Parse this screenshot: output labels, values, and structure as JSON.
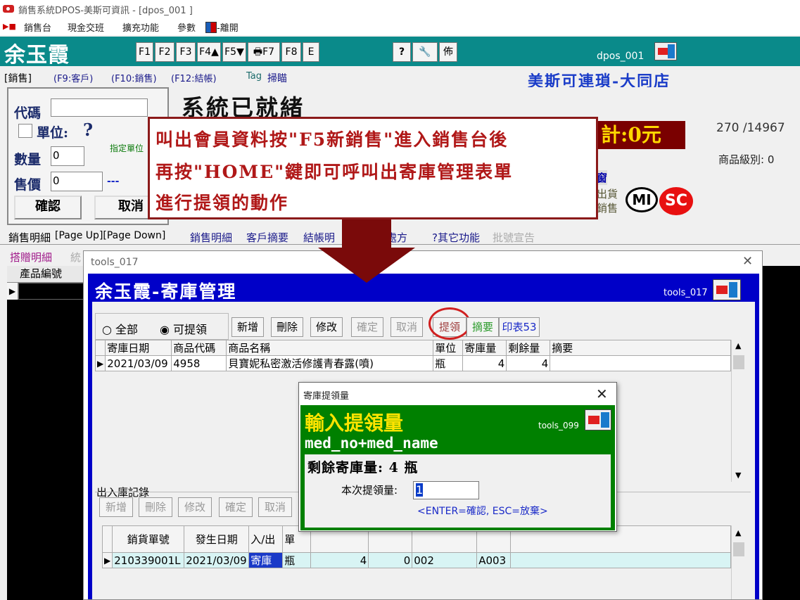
{
  "window": {
    "title": "銷售系統DPOS-美斯可資訊 - [dpos_001 ]"
  },
  "menu": {
    "items": [
      "銷售台",
      "現金交班",
      "擴充功能",
      "參數"
    ],
    "exit_label": "-離開"
  },
  "toolbar": {
    "user_name": "余玉霞",
    "keys": [
      "F1",
      "F2",
      "F3",
      "F4▲",
      "F5▼",
      "🖶F7",
      "F8",
      "E"
    ],
    "help": "?",
    "layout": "佈",
    "screen_id": "dpos_001"
  },
  "tabs": {
    "sales": "[銷售]",
    "customer": "(F9:客戶)",
    "sale": "(F10:銷售)",
    "checkout": "(F12:結帳)",
    "tag_label": "Tag",
    "scan": "掃瞄"
  },
  "store_name": "美斯可連瑣-大同店",
  "entry": {
    "code_label": "代碼",
    "unit_label": "單位:",
    "unit_value": "?",
    "assign_unit": "指定單位",
    "qty_label": "數量",
    "qty_value": "0",
    "price_label": "售價",
    "price_value": "0",
    "price_suffix": "---",
    "confirm": "確認",
    "cancel": "取消"
  },
  "status": {
    "text": "系統已就緒",
    "total": "計:0元",
    "count": "270 /14967",
    "level": "商品級別: 0",
    "window_fragment": "窗",
    "ship_1": "出貨",
    "ship_2": "銷售",
    "logo_mi": "MI",
    "logo_sc": "SC"
  },
  "detail_tabs": {
    "label": "銷售明細",
    "nav": "[Page Up][Page Down]",
    "items": [
      "銷售明細",
      "客戶摘要",
      "結帳明",
      "P處方",
      "?其它功能",
      "批號宣告"
    ]
  },
  "subtabs": {
    "gift": "搭贈明細",
    "stats": "統"
  },
  "left_grid": {
    "header": "產品編號"
  },
  "callout": {
    "line1": "叫出會員資料按\"F5新銷售\"進入銷售台後",
    "line2": "再按\"HOME\"鍵即可呼叫出寄庫管理表單",
    "line3": "進行提領的動作"
  },
  "tools": {
    "window_title": "tools_017",
    "heading": "余玉霞-寄庫管理",
    "id": "tools_017",
    "filter_all": "全部",
    "filter_available": "可提領",
    "buttons": {
      "add": "新增",
      "delete": "刪除",
      "edit": "修改",
      "confirm": "確定",
      "cancel": "取消",
      "withdraw": "提領",
      "summary": "摘要",
      "print": "印表53"
    },
    "columns": [
      "寄庫日期",
      "商品代碼",
      "商品名稱",
      "單位",
      "寄庫量",
      "剩餘量",
      "摘要"
    ],
    "rows": [
      {
        "date": "2021/03/09",
        "code": "4958",
        "name": "貝寶妮私密激活修護青春露(噴)",
        "unit": "瓶",
        "qty": "4",
        "remain": "4",
        "note": ""
      }
    ],
    "log_label": "出入庫記錄",
    "log_buttons": {
      "add": "新增",
      "delete": "刪除",
      "edit": "修改",
      "confirm": "確定",
      "cancel": "取消"
    },
    "log_columns": [
      "銷貨單號",
      "發生日期",
      "入/出",
      "單"
    ],
    "log_rows": [
      {
        "order": "210339001L",
        "date": "2021/03/09",
        "dir": "寄庫",
        "unit": "瓶",
        "qty": "4",
        "remain": "0",
        "c1": "002",
        "c2": "A003"
      }
    ]
  },
  "dialog": {
    "title": "寄庫提領量",
    "heading": "輸入提領量",
    "id": "tools_099",
    "med": "med_no+med_name",
    "remain": "剩餘寄庫量: 4 瓶",
    "qty_label": "本次提領量:",
    "qty_value": "1",
    "hint": "<ENTER=確認, ESC=放棄>"
  }
}
